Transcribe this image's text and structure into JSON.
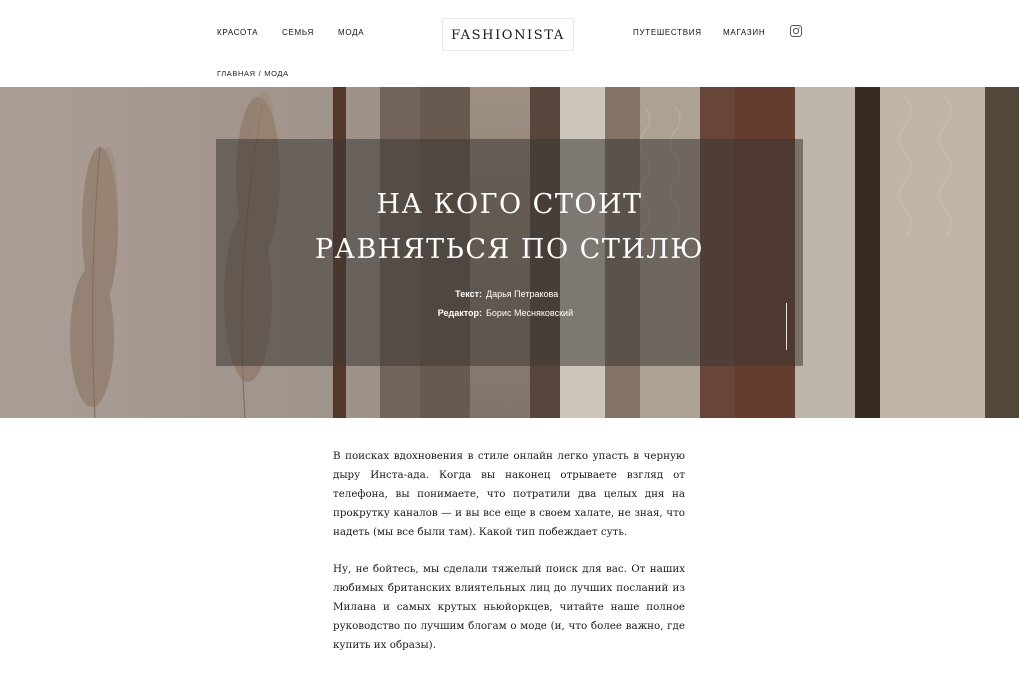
{
  "nav": {
    "left": [
      "КРАСОТА",
      "СЕМЬЯ",
      "МОДА"
    ],
    "right": [
      "ПУТЕШЕСТВИЯ",
      "МАГАЗИН"
    ],
    "logo": "FASHIONISTA",
    "social_icon": "instagram-icon"
  },
  "breadcrumb": {
    "home": "ГЛАВНАЯ",
    "separator": "/",
    "current": "МОДА"
  },
  "hero": {
    "title_line1": "НА КОГО СТОИТ",
    "title_line2": "РАВНЯТЬСЯ ПО СТИЛЮ",
    "credits": [
      {
        "label": "Текст:",
        "value": "Дарья Петракова"
      },
      {
        "label": "Редактор:",
        "value": "Борис Месняковский"
      }
    ]
  },
  "article": {
    "paragraphs": [
      "В поисках вдохновения в стиле онлайн легко упасть в черную дыру Инста-ада. Когда вы наконец отрываете взгляд от телефона, вы понимаете, что потратили два целых дня на прокрутку каналов — и вы все еще в своем халате, не зная, что надеть (мы все были там). Какой тип побеждает суть.",
      "Ну, не бойтесь, мы сделали тяжелый поиск для вас. От наших любимых британских влиятельных лиц до лучших посланий из Милана и самых крутых ньюйоркцев, читайте наше полное руководство по лучшим блогам о моде (и, что более важно, где купить их образы)."
    ]
  },
  "colors": {
    "overlay": "#3c3835",
    "text": "#1a1a1a",
    "hero_text": "#ffffff"
  }
}
